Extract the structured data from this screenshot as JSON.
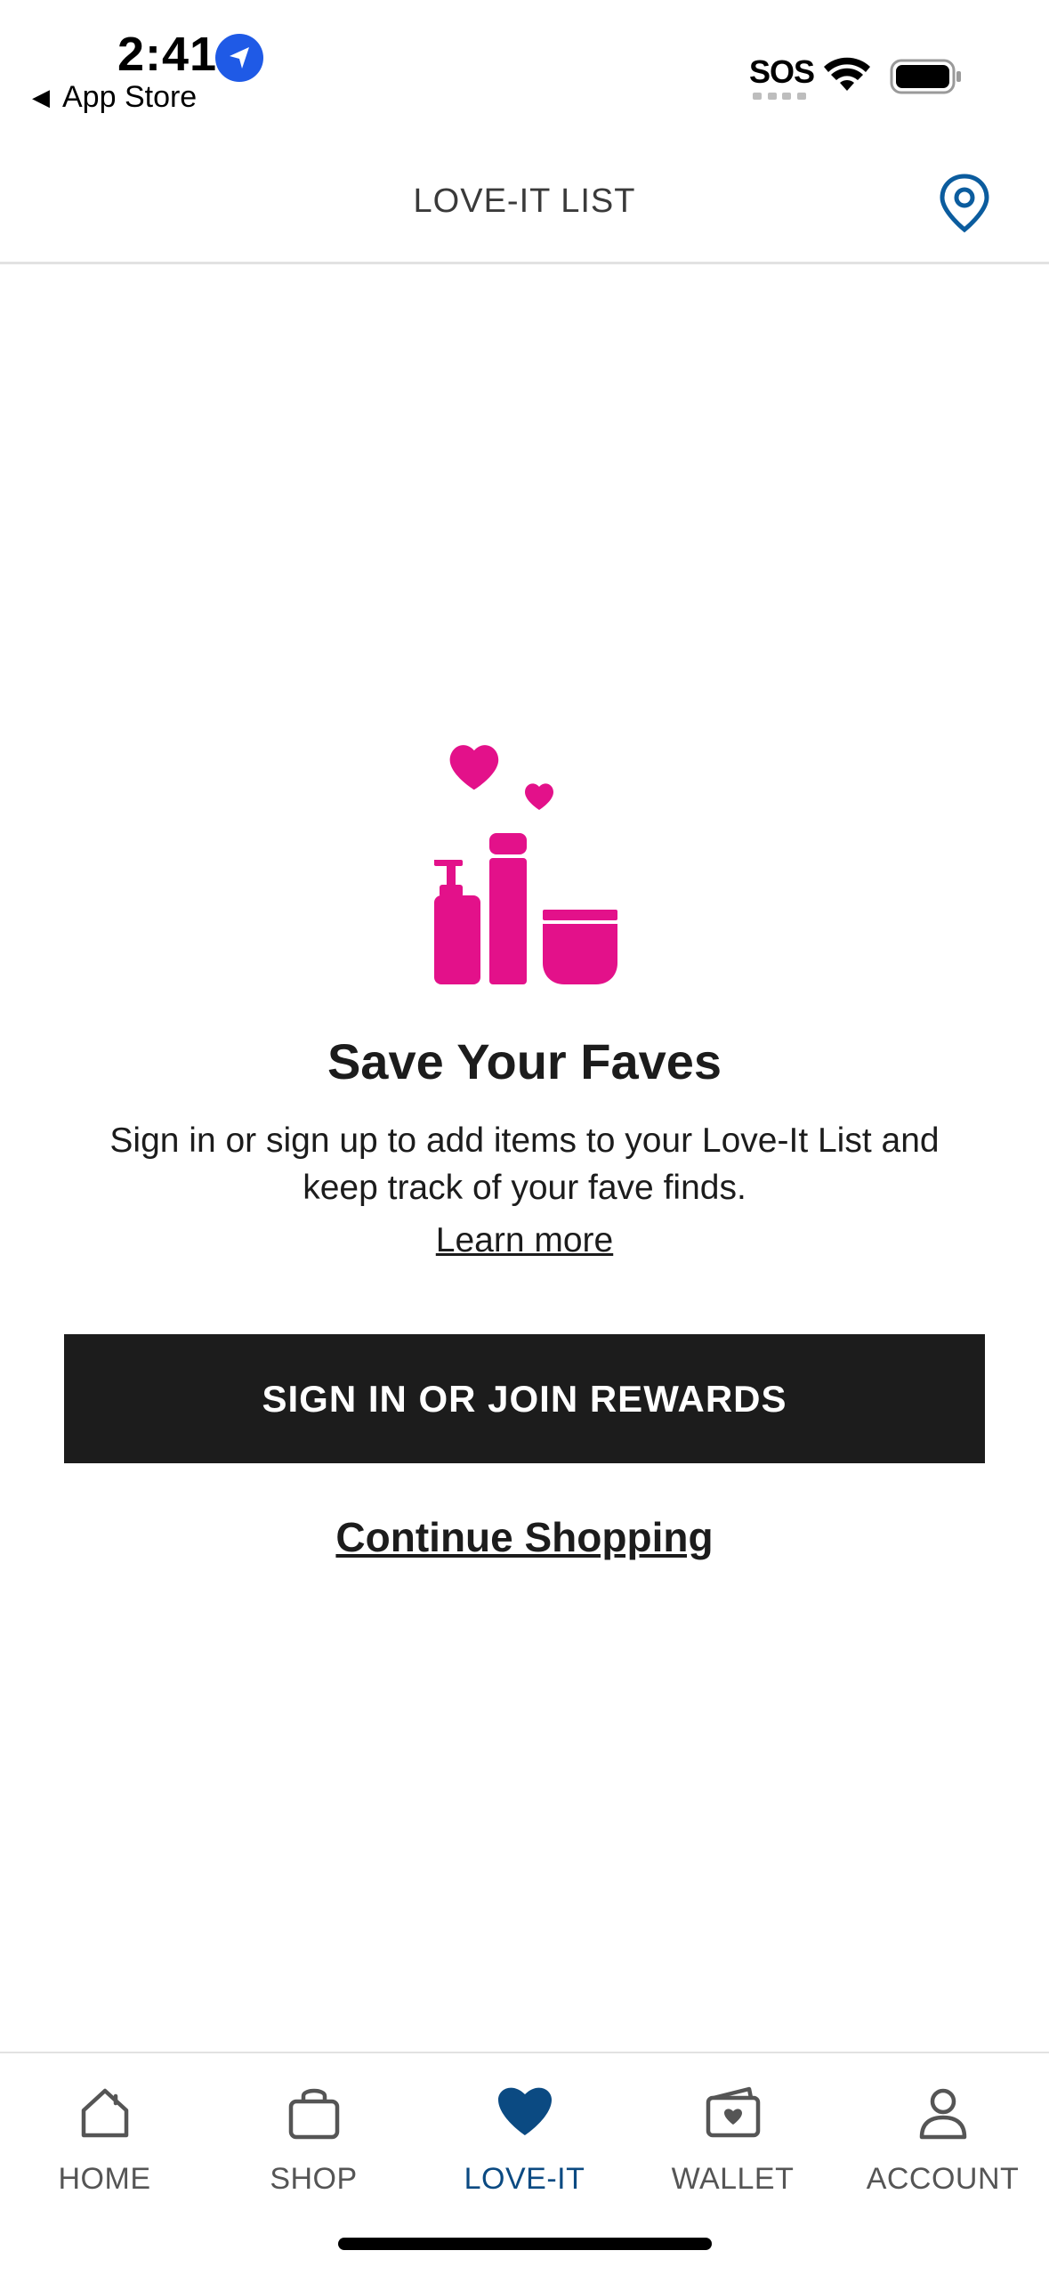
{
  "status_bar": {
    "time": "2:41",
    "back_label": "App Store",
    "sos": "SOS"
  },
  "header": {
    "title": "LOVE-IT LIST",
    "location_icon": "location-pin-icon"
  },
  "empty_state": {
    "illustration_icon": "beauty-products-hearts-icon",
    "title": "Save Your Faves",
    "description": "Sign in or sign up to add items to your Love-It List and keep track of your fave finds.",
    "learn_more": "Learn more",
    "primary_button": "SIGN IN OR JOIN REWARDS",
    "secondary_link": "Continue Shopping"
  },
  "tab_bar": {
    "tabs": [
      {
        "label": "HOME",
        "icon": "home-icon"
      },
      {
        "label": "SHOP",
        "icon": "shopping-bag-icon"
      },
      {
        "label": "LOVE-IT",
        "icon": "heart-icon",
        "active": true
      },
      {
        "label": "WALLET",
        "icon": "wallet-icon"
      },
      {
        "label": "ACCOUNT",
        "icon": "person-icon"
      }
    ]
  },
  "colors": {
    "accent_pink": "#e3118a",
    "active_tab": "#0b4a82",
    "button_bg": "#1c1c1c",
    "location_blue": "#0b5c9e",
    "status_location_blue": "#1f5ae6"
  }
}
